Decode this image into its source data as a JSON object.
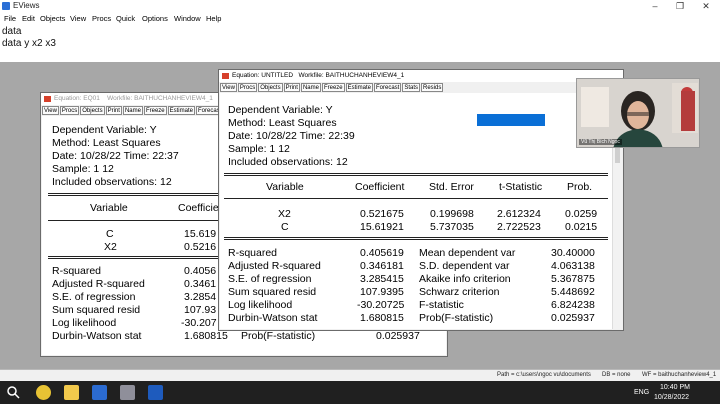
{
  "app": {
    "title": "EViews"
  },
  "menu": [
    "File",
    "Edit",
    "Objects",
    "View",
    "Procs",
    "Quick",
    "Options",
    "Window",
    "Help"
  ],
  "commands": [
    "data",
    "data y x2 x3"
  ],
  "back_window": {
    "title_name": "Equation: EQ01",
    "title_workfile": "Workfile: BAITHUCHANHEVIEW4_1",
    "buttons": [
      "View",
      "Procs",
      "Objects",
      "Print",
      "Name",
      "Freeze",
      "Estimate",
      "Forecast"
    ],
    "header": [
      "Dependent Variable: Y",
      "Method: Least Squares",
      "Date: 10/28/22   Time: 22:37",
      "Sample: 1 12",
      "Included observations: 12"
    ],
    "col_variable": "Variable",
    "col_coefficient": "Coefficie",
    "rows": [
      {
        "var": "C",
        "coef": "15.619"
      },
      {
        "var": "X2",
        "coef": "0.5216"
      }
    ],
    "stats": [
      {
        "label": "R-squared",
        "value": "0.4056"
      },
      {
        "label": "Adjusted R-squared",
        "value": "0.3461"
      },
      {
        "label": "S.E. of regression",
        "value": "3.2854"
      },
      {
        "label": "Sum squared resid",
        "value": "107.93"
      },
      {
        "label": "Log likelihood",
        "value": "-30.207"
      },
      {
        "label": "Durbin-Watson stat",
        "value": "1.680815"
      }
    ],
    "last_right_label": "Prob(F-statistic)",
    "last_right_value": "0.025937"
  },
  "front_window": {
    "title_name": "Equation: UNTITLED",
    "title_workfile": "Workfile: BAITHUCHANHEVIEW4_1",
    "buttons": [
      "View",
      "Procs",
      "Objects",
      "Print",
      "Name",
      "Freeze",
      "Estimate",
      "Forecast",
      "Stats",
      "Resids"
    ],
    "header": [
      "Dependent Variable: Y",
      "Method: Least Squares",
      "Date: 10/28/22   Time: 22:39",
      "Sample: 1 12",
      "Included observations: 12"
    ],
    "columns": [
      "Variable",
      "Coefficient",
      "Std. Error",
      "t-Statistic",
      "Prob."
    ],
    "rows": [
      {
        "var": "X2",
        "coef": "0.521675",
        "se": "0.199698",
        "t": "2.612324",
        "p": "0.0259"
      },
      {
        "var": "C",
        "coef": "15.61921",
        "se": "5.737035",
        "t": "2.722523",
        "p": "0.0215"
      }
    ],
    "stats": [
      {
        "label": "R-squared",
        "value": "0.405619",
        "label2": "Mean dependent var",
        "value2": "30.40000"
      },
      {
        "label": "Adjusted R-squared",
        "value": "0.346181",
        "label2": "S.D. dependent var",
        "value2": "4.063138"
      },
      {
        "label": "S.E. of regression",
        "value": "3.285415",
        "label2": "Akaike info criterion",
        "value2": "5.367875"
      },
      {
        "label": "Sum squared resid",
        "value": "107.9395",
        "label2": "Schwarz criterion",
        "value2": "5.448692"
      },
      {
        "label": "Log likelihood",
        "value": "-30.20725",
        "label2": "F-statistic",
        "value2": "6.824238"
      },
      {
        "label": "Durbin-Watson stat",
        "value": "1.680815",
        "label2": "Prob(F-statistic)",
        "value2": "0.025937"
      }
    ]
  },
  "webcam": {
    "name": "Vũ Thị Bích Ngọc"
  },
  "statusbar": {
    "path": "Path = c:\\users\\ngoc vu\\documents",
    "db": "DB = none",
    "wf": "WF = baithuchanheview4_1"
  },
  "taskbar": {
    "lang": "ENG",
    "time": "10:40 PM",
    "date": "10/28/2022"
  }
}
